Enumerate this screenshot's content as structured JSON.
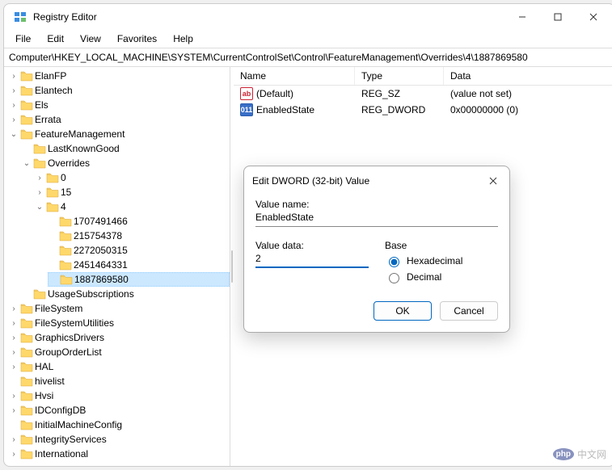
{
  "titlebar": {
    "title": "Registry Editor"
  },
  "menu": {
    "file": "File",
    "edit": "Edit",
    "view": "View",
    "favorites": "Favorites",
    "help": "Help"
  },
  "address": "Computer\\HKEY_LOCAL_MACHINE\\SYSTEM\\CurrentControlSet\\Control\\FeatureManagement\\Overrides\\4\\1887869580",
  "tree": {
    "items": [
      {
        "label": "ElanFP",
        "chev": "closed"
      },
      {
        "label": "Elantech",
        "chev": "closed"
      },
      {
        "label": "Els",
        "chev": "closed"
      },
      {
        "label": "Errata",
        "chev": "closed"
      },
      {
        "label": "FeatureManagement",
        "chev": "open",
        "children": [
          {
            "label": "LastKnownGood",
            "chev": "none"
          },
          {
            "label": "Overrides",
            "chev": "open",
            "children": [
              {
                "label": "0",
                "chev": "closed"
              },
              {
                "label": "15",
                "chev": "closed"
              },
              {
                "label": "4",
                "chev": "open",
                "children": [
                  {
                    "label": "1707491466",
                    "chev": "none"
                  },
                  {
                    "label": "215754378",
                    "chev": "none"
                  },
                  {
                    "label": "2272050315",
                    "chev": "none"
                  },
                  {
                    "label": "2451464331",
                    "chev": "none"
                  },
                  {
                    "label": "1887869580",
                    "chev": "none",
                    "selected": true
                  }
                ]
              }
            ]
          },
          {
            "label": "UsageSubscriptions",
            "chev": "none"
          }
        ]
      },
      {
        "label": "FileSystem",
        "chev": "closed"
      },
      {
        "label": "FileSystemUtilities",
        "chev": "closed"
      },
      {
        "label": "GraphicsDrivers",
        "chev": "closed"
      },
      {
        "label": "GroupOrderList",
        "chev": "closed"
      },
      {
        "label": "HAL",
        "chev": "closed"
      },
      {
        "label": "hivelist",
        "chev": "none"
      },
      {
        "label": "Hvsi",
        "chev": "closed"
      },
      {
        "label": "IDConfigDB",
        "chev": "closed"
      },
      {
        "label": "InitialMachineConfig",
        "chev": "none"
      },
      {
        "label": "IntegrityServices",
        "chev": "closed"
      },
      {
        "label": "International",
        "chev": "closed"
      }
    ]
  },
  "list": {
    "headers": {
      "name": "Name",
      "type": "Type",
      "data": "Data"
    },
    "rows": [
      {
        "icon": "sz",
        "name": "(Default)",
        "type": "REG_SZ",
        "data": "(value not set)"
      },
      {
        "icon": "dw",
        "name": "EnabledState",
        "type": "REG_DWORD",
        "data": "0x00000000 (0)"
      }
    ]
  },
  "dialog": {
    "title": "Edit DWORD (32-bit) Value",
    "value_name_label": "Value name:",
    "value_name": "EnabledState",
    "value_data_label": "Value data:",
    "value_data": "2",
    "base_label": "Base",
    "hex": "Hexadecimal",
    "dec": "Decimal",
    "ok": "OK",
    "cancel": "Cancel"
  },
  "watermark": "中文网"
}
